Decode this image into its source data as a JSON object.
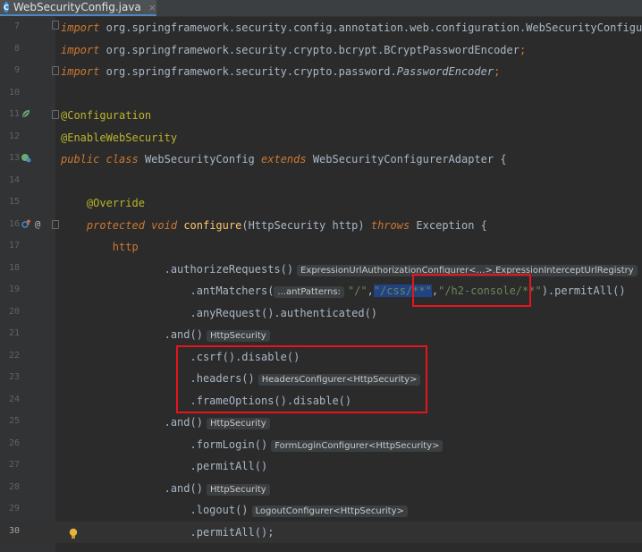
{
  "tab": {
    "filename": "WebSecurityConfig.java",
    "icon": "java-class-icon",
    "close": "×"
  },
  "lines": [
    {
      "num": "7"
    },
    {
      "num": "8"
    },
    {
      "num": "9"
    },
    {
      "num": "10"
    },
    {
      "num": "11"
    },
    {
      "num": "12"
    },
    {
      "num": "13"
    },
    {
      "num": "14"
    },
    {
      "num": "15"
    },
    {
      "num": "16"
    },
    {
      "num": "17"
    },
    {
      "num": "18"
    },
    {
      "num": "19"
    },
    {
      "num": "20"
    },
    {
      "num": "21"
    },
    {
      "num": "22"
    },
    {
      "num": "23"
    },
    {
      "num": "24"
    },
    {
      "num": "25"
    },
    {
      "num": "26"
    },
    {
      "num": "27"
    },
    {
      "num": "28"
    },
    {
      "num": "29"
    },
    {
      "num": "30"
    }
  ],
  "code": {
    "l7_kw": "import",
    "l7_pkg": " org.springframework.security.config.annotation.web.configuration.",
    "l7_cls": "WebSecurityConfigurerA",
    "l8_kw": "import",
    "l8_pkg": " org.springframework.security.crypto.bcrypt.",
    "l8_cls": "BCryptPasswordEncoder",
    "l8_end": ";",
    "l9_kw": "import",
    "l9_pkg": " org.springframework.security.crypto.password.",
    "l9_cls": "PasswordEncoder",
    "l9_end": ";",
    "l11": "@Configuration",
    "l12": "@EnableWebSecurity",
    "l13_public": "public",
    "l13_class": "class",
    "l13_name": "WebSecurityConfig",
    "l13_extends": "extends",
    "l13_parent": "WebSecurityConfigurerAdapter",
    "l13_brace": " {",
    "l15": "@Override",
    "l16_protected": "protected",
    "l16_void": "void",
    "l16_method": "configure",
    "l16_params": "(HttpSecurity http) ",
    "l16_throws": "throws",
    "l16_exc": " Exception {",
    "l17": "http",
    "l18_call": ".authorizeRequests()",
    "l18_hint": "ExpressionUrlAuthorizationConfigurer<…>.ExpressionInterceptUrlRegistry",
    "l19_call": ".antMatchers(",
    "l19_param": "...antPatterns:",
    "l19_s1": "\"/\"",
    "l19_comma1": ",",
    "l19_s2": "\"/css/**\"",
    "l19_comma2": ",",
    "l19_s3": "\"/h2-console/**\"",
    "l19_close": ")",
    "l19_end": ".permitAll()",
    "l20": ".anyRequest().authenticated()",
    "l21_call": ".and()",
    "l21_hint": "HttpSecurity",
    "l22": ".csrf().disable()",
    "l23_call": ".headers()",
    "l23_hint": "HeadersConfigurer<HttpSecurity>",
    "l24": ".frameOptions().disable()",
    "l25_call": ".and()",
    "l25_hint": "HttpSecurity",
    "l26_call": ".formLogin()",
    "l26_hint": "FormLoginConfigurer<HttpSecurity>",
    "l27": ".permitAll()",
    "l28_call": ".and()",
    "l28_hint": "HttpSecurity",
    "l29_call": ".logout()",
    "l29_hint": "LogoutConfigurer<HttpSecurity>",
    "l30": ".permitAll();"
  },
  "gutter_icons": {
    "l11": "spring-bean-icon",
    "l13": "spring-config-icon",
    "l16_override": "override-method-icon",
    "l16_at": "@",
    "l30": "intention-bulb-icon"
  },
  "colors": {
    "background": "#2b2b2b",
    "gutter": "#313335",
    "keyword": "#cc7832",
    "annotation": "#bbb529",
    "method": "#ffc66d",
    "string": "#6a8759",
    "text": "#a9b7c6",
    "highlight_box": "#e8141c"
  }
}
